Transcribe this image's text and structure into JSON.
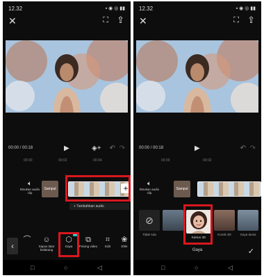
{
  "left": {
    "status": {
      "time": "12.32",
      "icons": "▪ ◉ ◎ ▮▮"
    },
    "topbar": {
      "close_icon": "✕",
      "expand_icon": "⛶",
      "export_icon": "⇪"
    },
    "controls": {
      "timecode": "00:00 / 00:18",
      "play_icon": "▶",
      "keyframe_icon": "◈+",
      "undo_icon": "↶",
      "redo_icon": "↷"
    },
    "ruler": [
      "00:00",
      "00:02",
      "00:04"
    ],
    "track": {
      "audio_label": "Bisukan audio clip",
      "cover_label": "Sampul"
    },
    "add_audio": "+ Tambahkan audio",
    "toolbar": {
      "back_icon": "‹",
      "tools": [
        {
          "icon": "⌒",
          "label": ""
        },
        {
          "icon": "☺",
          "label": "Sapus latar belakang"
        },
        {
          "icon": "⬡",
          "label": "Gaya",
          "badge": "New"
        },
        {
          "icon": "⧉",
          "label": "Potong video"
        },
        {
          "icon": "⌗",
          "label": "Edit"
        },
        {
          "icon": "❀",
          "label": "Efek"
        }
      ]
    },
    "nav": {
      "square": "□",
      "circle": "○",
      "back": "◁"
    }
  },
  "right": {
    "status": {
      "time": "12.32",
      "icons": "▪ ◉ ◎ ▮▮"
    },
    "topbar": {
      "close_icon": "✕",
      "expand_icon": "⛶",
      "export_icon": "⇪"
    },
    "controls": {
      "timecode": "00:00 / 00:18",
      "play_icon": "▶",
      "undo_icon": "↶",
      "redo_icon": "↷"
    },
    "ruler": [
      "00:00",
      "00:02"
    ],
    "track": {
      "audio_label": "Bisukan audio clip",
      "cover_label": "Sampul"
    },
    "styles": [
      {
        "label": "Tidak Ada",
        "icon": "⊘"
      },
      {
        "label": ""
      },
      {
        "label": "Kartun 3D",
        "selected": true
      },
      {
        "label": "Komik 3D"
      },
      {
        "label": "Gaya dunia"
      }
    ],
    "panel_title": "Gaya",
    "confirm_icon": "✓",
    "nav": {
      "square": "□",
      "circle": "○",
      "back": "◁"
    }
  },
  "colors": {
    "highlight": "#d9171e",
    "background": "#0d0d0d",
    "badge": "#19c2b6"
  }
}
